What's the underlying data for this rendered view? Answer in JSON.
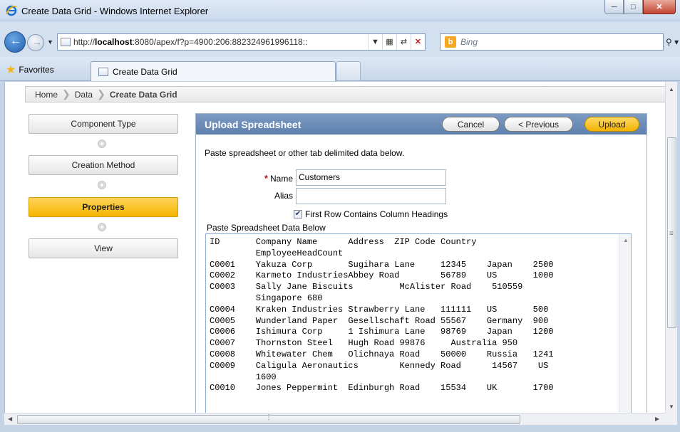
{
  "window": {
    "title": "Create Data Grid - Windows Internet Explorer",
    "minimize_icon": "minimize-icon",
    "maximize_icon": "maximize-icon",
    "close_icon": "close-icon"
  },
  "address_bar": {
    "url_prefix": "http://",
    "url_host": "localhost",
    "url_rest": ":8080/apex/f?p=4900:206:882324961996118::"
  },
  "search": {
    "engine": "Bing",
    "placeholder": "Bing"
  },
  "favorites": {
    "label": "Favorites"
  },
  "tabs": [
    {
      "label": "Create Data Grid"
    }
  ],
  "breadcrumb": {
    "items": [
      "Home",
      "Data",
      "Create Data Grid"
    ]
  },
  "wizard": {
    "steps": [
      {
        "label": "Component Type",
        "active": false
      },
      {
        "label": "Creation Method",
        "active": false
      },
      {
        "label": "Properties",
        "active": true
      },
      {
        "label": "View",
        "active": false
      }
    ]
  },
  "region": {
    "title": "Upload Spreadsheet",
    "buttons": {
      "cancel": "Cancel",
      "previous": "< Previous",
      "upload": "Upload"
    },
    "instructions": "Paste spreadsheet or other tab delimited data below.",
    "name": {
      "label": "Name",
      "value": "Customers",
      "required": true
    },
    "alias": {
      "label": "Alias",
      "value": ""
    },
    "first_row_headings": {
      "label": "First Row Contains Column Headings",
      "checked": true
    },
    "paste_label": "Paste Spreadsheet Data Below",
    "paste_lines": [
      "ID       Company Name      Address  ZIP Code Country",
      "         EmployeeHeadCount",
      "C0001    Yakuza Corp       Sugihara Lane     12345    Japan    2500",
      "C0002    Karmeto IndustriesAbbey Road        56789    US       1000",
      "C0003    Sally Jane Biscuits         McAlister Road    510559",
      "         Singapore 680",
      "C0004    Kraken Industries Strawberry Lane   111111   US       500",
      "C0005    Wunderland Paper  Gesellschaft Road 55567    Germany  900",
      "C0006    Ishimura Corp     1 Ishimura Lane   98769    Japan    1200",
      "C0007    Thornston Steel   Hugh Road 99876     Australia 950",
      "C0008    Whitewater Chem   Olichnaya Road    50000    Russia   1241",
      "C0009    Caligula Aeronautics        Kennedy Road      14567    US",
      "         1600",
      "C0010    Jones Peppermint  Edinburgh Road    15534    UK       1700"
    ]
  }
}
